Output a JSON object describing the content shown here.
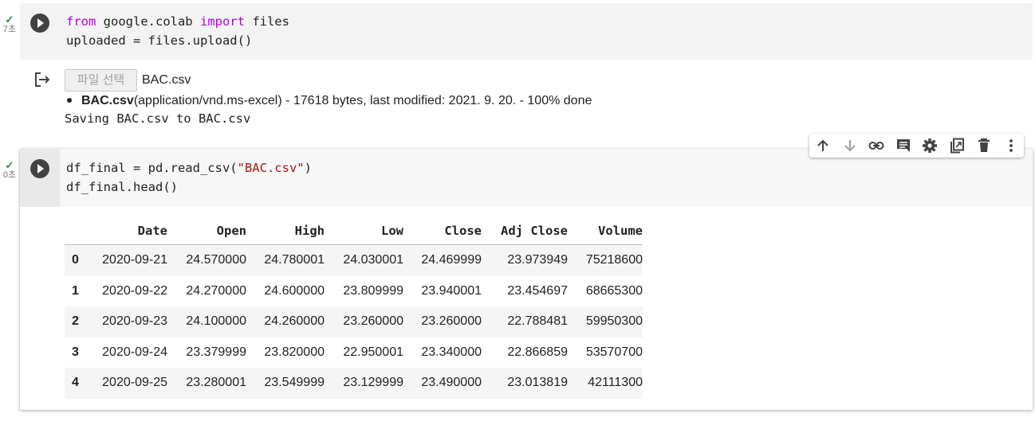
{
  "cell1": {
    "duration": "7초",
    "code_lines": [
      [
        {
          "t": "from",
          "c": "kw"
        },
        {
          "t": " google.colab ",
          "c": ""
        },
        {
          "t": "import",
          "c": "kw"
        },
        {
          "t": " files",
          "c": ""
        }
      ],
      [
        {
          "t": "uploaded = files.upload()",
          "c": ""
        }
      ]
    ],
    "output": {
      "file_button_label": "파일 선택",
      "file_name": "BAC.csv",
      "bullet_bold": "BAC.csv",
      "bullet_rest": "(application/vnd.ms-excel) - 17618 bytes, last modified: 2021. 9. 20. - 100% done",
      "saving_text": "Saving BAC.csv to BAC.csv"
    }
  },
  "toolbar": {
    "icons": [
      "arrow-up-icon",
      "arrow-down-icon",
      "link-icon",
      "comment-icon",
      "gear-icon",
      "mirror-cell-icon",
      "trash-icon",
      "more-vert-icon"
    ]
  },
  "cell2": {
    "duration": "0초",
    "code_lines": [
      [
        {
          "t": "df_final = pd.read_csv(",
          "c": ""
        },
        {
          "t": "\"BAC.csv\"",
          "c": "str"
        },
        {
          "t": ")",
          "c": ""
        }
      ],
      [
        {
          "t": "df_final.head()",
          "c": ""
        }
      ]
    ],
    "table": {
      "columns": [
        "",
        "Date",
        "Open",
        "High",
        "Low",
        "Close",
        "Adj Close",
        "Volume"
      ],
      "rows": [
        [
          "0",
          "2020-09-21",
          "24.570000",
          "24.780001",
          "24.030001",
          "24.469999",
          "23.973949",
          "75218600"
        ],
        [
          "1",
          "2020-09-22",
          "24.270000",
          "24.600000",
          "23.809999",
          "23.940001",
          "23.454697",
          "68665300"
        ],
        [
          "2",
          "2020-09-23",
          "24.100000",
          "24.260000",
          "23.260000",
          "23.260000",
          "22.788481",
          "59950300"
        ],
        [
          "3",
          "2020-09-24",
          "23.379999",
          "23.820000",
          "22.950001",
          "23.340000",
          "22.866859",
          "53570700"
        ],
        [
          "4",
          "2020-09-25",
          "23.280001",
          "23.549999",
          "23.129999",
          "23.490000",
          "23.013819",
          "42111300"
        ]
      ]
    }
  }
}
